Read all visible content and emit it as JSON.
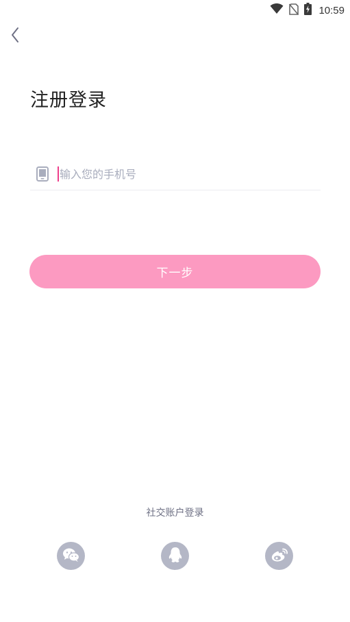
{
  "status_bar": {
    "time": "10:59"
  },
  "header": {
    "back_icon": "chevron-left-icon"
  },
  "title": "注册登录",
  "phone_input": {
    "icon": "phone-icon",
    "placeholder": "输入您的手机号",
    "value": ""
  },
  "next_button": {
    "label": "下一步",
    "color": "#fc9ac1"
  },
  "social": {
    "label": "社交账户登录",
    "providers": [
      {
        "name": "wechat",
        "icon": "wechat-icon"
      },
      {
        "name": "qq",
        "icon": "qq-icon"
      },
      {
        "name": "weibo",
        "icon": "weibo-icon"
      }
    ],
    "icon_bg": "#b4b7c6"
  },
  "colors": {
    "accent_pink": "#fc9ac1",
    "caret": "#ee3d8a",
    "placeholder": "#a9adbd"
  }
}
